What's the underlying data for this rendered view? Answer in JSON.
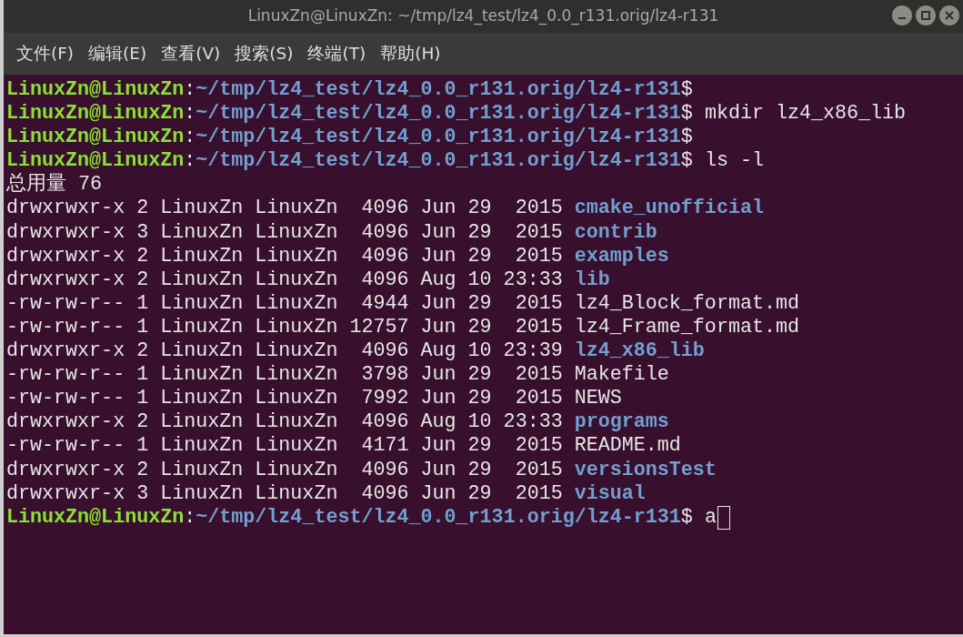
{
  "window": {
    "title": "LinuxZn@LinuxZn: ~/tmp/lz4_test/lz4_0.0_r131.orig/lz4-r131"
  },
  "menu": [
    "文件(F)",
    "编辑(E)",
    "查看(V)",
    "搜索(S)",
    "终端(T)",
    "帮助(H)"
  ],
  "terminal": {
    "lines": [
      {
        "kind": "prompt",
        "user": "LinuxZn@LinuxZn",
        "separator": ":",
        "path": "~/tmp/lz4_test/lz4_0.0_r131.orig/lz4-r131",
        "symbol": "$"
      },
      {
        "kind": "prompt",
        "user": "LinuxZn@LinuxZn",
        "separator": ":",
        "path": "~/tmp/lz4_test/lz4_0.0_r131.orig/lz4-r131",
        "symbol": "$",
        "command": "mkdir lz4_x86_lib"
      },
      {
        "kind": "prompt",
        "user": "LinuxZn@LinuxZn",
        "separator": ":",
        "path": "~/tmp/lz4_test/lz4_0.0_r131.orig/lz4-r131",
        "symbol": "$"
      },
      {
        "kind": "prompt",
        "user": "LinuxZn@LinuxZn",
        "separator": ":",
        "path": "~/tmp/lz4_test/lz4_0.0_r131.orig/lz4-r131",
        "symbol": "$",
        "command": "ls -l"
      },
      {
        "kind": "text",
        "text": "总用量 76"
      },
      {
        "kind": "entry",
        "details": "drwxrwxr-x 2 LinuxZn LinuxZn  4096 Jun 29  2015",
        "name": "cmake_unofficial",
        "directory": true
      },
      {
        "kind": "entry",
        "details": "drwxrwxr-x 3 LinuxZn LinuxZn  4096 Jun 29  2015",
        "name": "contrib",
        "directory": true
      },
      {
        "kind": "entry",
        "details": "drwxrwxr-x 2 LinuxZn LinuxZn  4096 Jun 29  2015",
        "name": "examples",
        "directory": true
      },
      {
        "kind": "entry",
        "details": "drwxrwxr-x 2 LinuxZn LinuxZn  4096 Aug 10 23:33",
        "name": "lib",
        "directory": true
      },
      {
        "kind": "entry",
        "details": "-rw-rw-r-- 1 LinuxZn LinuxZn  4944 Jun 29  2015",
        "name": "lz4_Block_format.md",
        "directory": false
      },
      {
        "kind": "entry",
        "details": "-rw-rw-r-- 1 LinuxZn LinuxZn 12757 Jun 29  2015",
        "name": "lz4_Frame_format.md",
        "directory": false
      },
      {
        "kind": "entry",
        "details": "drwxrwxr-x 2 LinuxZn LinuxZn  4096 Aug 10 23:39",
        "name": "lz4_x86_lib",
        "directory": true
      },
      {
        "kind": "entry",
        "details": "-rw-rw-r-- 1 LinuxZn LinuxZn  3798 Jun 29  2015",
        "name": "Makefile",
        "directory": false
      },
      {
        "kind": "entry",
        "details": "-rw-rw-r-- 1 LinuxZn LinuxZn  7992 Jun 29  2015",
        "name": "NEWS",
        "directory": false
      },
      {
        "kind": "entry",
        "details": "drwxrwxr-x 2 LinuxZn LinuxZn  4096 Aug 10 23:33",
        "name": "programs",
        "directory": true
      },
      {
        "kind": "entry",
        "details": "-rw-rw-r-- 1 LinuxZn LinuxZn  4171 Jun 29  2015",
        "name": "README.md",
        "directory": false
      },
      {
        "kind": "entry",
        "details": "drwxrwxr-x 2 LinuxZn LinuxZn  4096 Jun 29  2015",
        "name": "versionsTest",
        "directory": true
      },
      {
        "kind": "entry",
        "details": "drwxrwxr-x 3 LinuxZn LinuxZn  4096 Jun 29  2015",
        "name": "visual",
        "directory": true
      },
      {
        "kind": "prompt",
        "user": "LinuxZn@LinuxZn",
        "separator": ":",
        "path": "~/tmp/lz4_test/lz4_0.0_r131.orig/lz4-r131",
        "symbol": "$",
        "command": "a",
        "cursor": true
      }
    ]
  }
}
